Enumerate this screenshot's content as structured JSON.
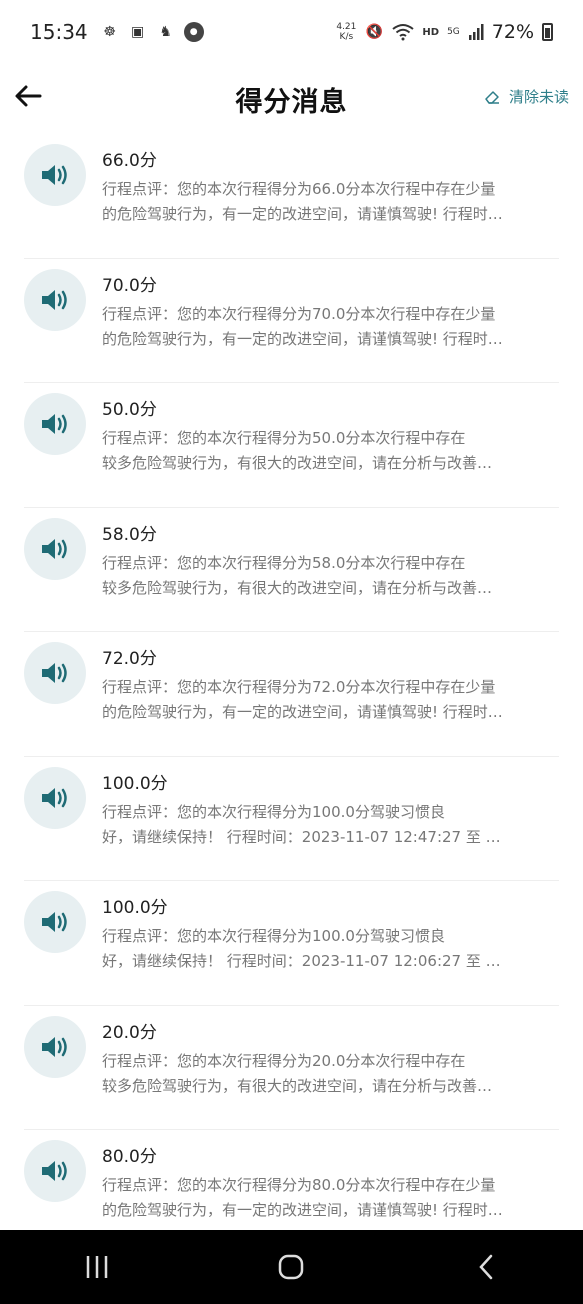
{
  "status_bar": {
    "time": "15:34",
    "net_speed_value": "4.21",
    "net_speed_unit": "K/s",
    "hd": "HD",
    "signal": "5G",
    "battery": "72%"
  },
  "header": {
    "title": "得分消息",
    "clear_label": "清除未读"
  },
  "messages": [
    {
      "title": "66.0分",
      "line1": "行程点评：您的本次行程得分为66.0分本次行程中存在少量",
      "line2": "的危险驾驶行为，有一定的改进空间，请谨慎驾驶! 行程时…"
    },
    {
      "title": "70.0分",
      "line1": "行程点评：您的本次行程得分为70.0分本次行程中存在少量",
      "line2": "的危险驾驶行为，有一定的改进空间，请谨慎驾驶! 行程时…"
    },
    {
      "title": "50.0分",
      "line1": "行程点评：您的本次行程得分为50.0分本次行程中存在",
      "line2": "较多危险驾驶行为，有很大的改进空间，请在分析与改善…"
    },
    {
      "title": "58.0分",
      "line1": "行程点评：您的本次行程得分为58.0分本次行程中存在",
      "line2": "较多危险驾驶行为，有很大的改进空间，请在分析与改善…"
    },
    {
      "title": "72.0分",
      "line1": "行程点评：您的本次行程得分为72.0分本次行程中存在少量",
      "line2": "的危险驾驶行为，有一定的改进空间，请谨慎驾驶! 行程时…"
    },
    {
      "title": "100.0分",
      "line1": "行程点评：您的本次行程得分为100.0分驾驶习惯良",
      "line2": "好，请继续保持！ 行程时间：2023-11-07 12:47:27 至 …"
    },
    {
      "title": "100.0分",
      "line1": "行程点评：您的本次行程得分为100.0分驾驶习惯良",
      "line2": "好，请继续保持！ 行程时间：2023-11-07 12:06:27 至 …"
    },
    {
      "title": "20.0分",
      "line1": "行程点评：您的本次行程得分为20.0分本次行程中存在",
      "line2": "较多危险驾驶行为，有很大的改进空间，请在分析与改善…"
    },
    {
      "title": "80.0分",
      "line1": "行程点评：您的本次行程得分为80.0分本次行程中存在少量",
      "line2": "的危险驾驶行为，有一定的改进空间，请谨慎驾驶! 行程时…"
    }
  ],
  "icons": {
    "message": "speaker-icon",
    "back": "arrow-left-icon",
    "clear": "eraser-icon"
  },
  "colors": {
    "accent": "#2f7f8a",
    "speaker": "#1f6b75",
    "avatar_bg": "#e7eff1"
  }
}
